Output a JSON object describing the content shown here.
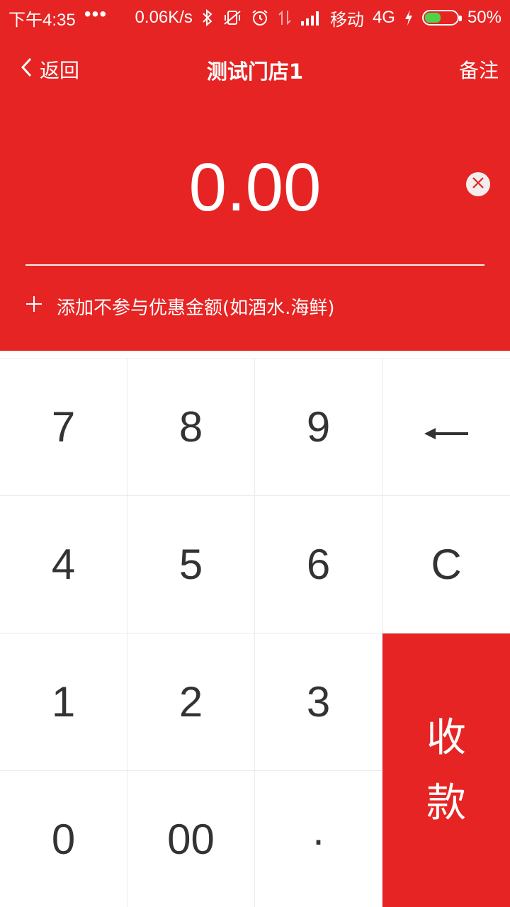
{
  "status_bar": {
    "time": "下午4:35",
    "dots": "•••",
    "speed": "0.06K/s",
    "carrier": "移动",
    "network": "4G",
    "battery": "50%",
    "battery_level": 0.5,
    "icons": [
      "bluetooth-icon",
      "vibrate-off-icon",
      "alarm-icon",
      "data-arrows-icon",
      "signal-icon",
      "charging-icon",
      "battery-icon"
    ]
  },
  "navbar": {
    "back_label": "返回",
    "title": "测试门店1",
    "note_label": "备注"
  },
  "amount": "0.00",
  "extra_label": "添加不参与优惠金额(如酒水.海鲜)",
  "keypad": {
    "k7": "7",
    "k8": "8",
    "k9": "9",
    "k4": "4",
    "k5": "5",
    "k6": "6",
    "k1": "1",
    "k2": "2",
    "k3": "3",
    "k0": "0",
    "k00": "00",
    "kdot": "·",
    "clear": "C",
    "pay_top": "收",
    "pay_bottom": "款"
  },
  "colors": {
    "primary": "#e52423",
    "key_text": "#333333",
    "battery_fill": "#4fd14a"
  }
}
